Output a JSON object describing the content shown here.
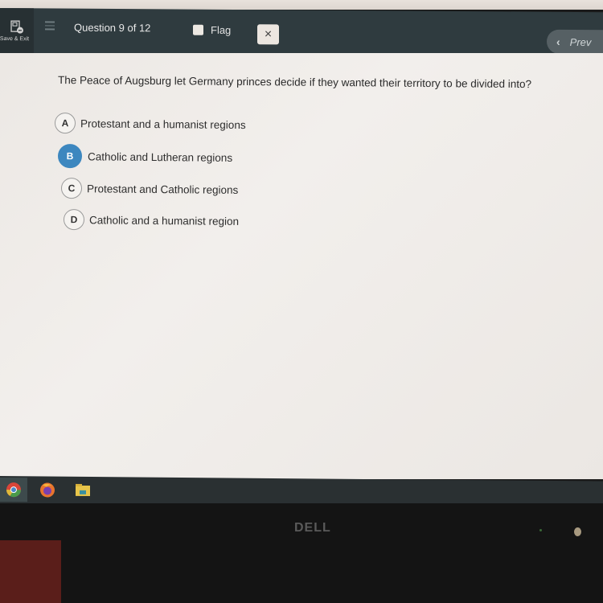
{
  "header": {
    "save_exit_label": "Save & Exit",
    "question_counter": "Question 9 of 12",
    "flag_label": "Flag",
    "flag_checked": false,
    "close_symbol": "×",
    "prev_label": "Prev",
    "prev_icon": "‹"
  },
  "question": {
    "text": "The Peace of Augsburg let Germany  princes decide if they wanted their territory to be divided into?",
    "selected": "B",
    "answers": [
      {
        "letter": "A",
        "text": "Protestant and a humanist regions"
      },
      {
        "letter": "B",
        "text": "Catholic and Lutheran regions"
      },
      {
        "letter": "C",
        "text": "Protestant and Catholic regions"
      },
      {
        "letter": "D",
        "text": "Catholic and a humanist region"
      }
    ]
  },
  "colors": {
    "header_bg": "#2f3b3f",
    "selected_accent": "#3d87bf"
  },
  "taskbar": {
    "icons": [
      "chrome-icon",
      "firefox-icon",
      "file-explorer-icon"
    ]
  },
  "monitor": {
    "brand": "DELL"
  }
}
